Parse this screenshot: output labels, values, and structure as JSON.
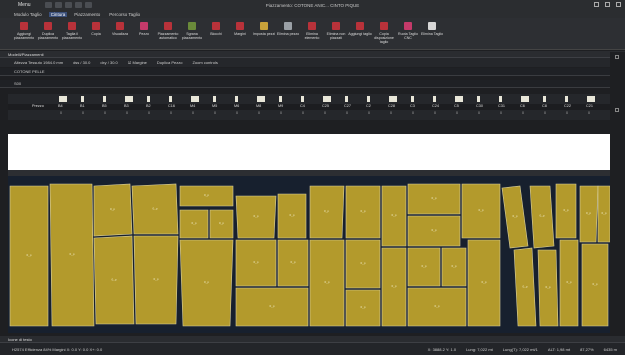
{
  "titlebar": {
    "menu": "Menu",
    "title": "Piazzamento: COTONE ANIC... CINTO PIQUE"
  },
  "tabs": [
    {
      "label": "Modulo Taglio",
      "active": false
    },
    {
      "label": "Cintura",
      "active": true
    },
    {
      "label": "Piazzamento",
      "active": false
    },
    {
      "label": "Percorso Taglio",
      "active": false
    }
  ],
  "ribbon": [
    {
      "label": "Aggiungi piazzamento",
      "icon": "add-marker-icon",
      "color": "#b8323a"
    },
    {
      "label": "Duplica piazzamento",
      "icon": "duplicate-icon",
      "color": "#b8323a"
    },
    {
      "label": "Taglia il piazzamento",
      "icon": "cut-marker-icon",
      "color": "#b8323a"
    },
    {
      "label": "Copia",
      "icon": "copy-icon",
      "color": "#b8323a"
    },
    {
      "label": "Visualizza",
      "icon": "view-icon",
      "color": "#b8323a"
    },
    {
      "label": "Pezzo",
      "icon": "piece-icon",
      "color": "#c43a6a"
    },
    {
      "label": "Piazzamento automatico",
      "icon": "auto-marker-icon",
      "color": "#b8323a"
    },
    {
      "label": "Sgrana piazzamento",
      "icon": "unplace-icon",
      "color": "#6a8a3a"
    },
    {
      "label": "Blocchi",
      "icon": "blocks-icon",
      "color": "#b8323a"
    },
    {
      "label": "Margini",
      "icon": "margins-icon",
      "color": "#b8323a"
    },
    {
      "label": "Imposta pezzi",
      "icon": "set-pieces-icon",
      "color": "#c8a23a"
    },
    {
      "label": "Elimina pezzo",
      "icon": "delete-piece-icon",
      "color": "#9aa0a6"
    },
    {
      "label": "Elimina elemento",
      "icon": "delete-element-icon",
      "color": "#b8323a"
    },
    {
      "label": "Elimina non piazzati",
      "icon": "delete-unplaced-icon",
      "color": "#b8323a"
    },
    {
      "label": "Aggiungi taglio",
      "icon": "add-cut-icon",
      "color": "#b8323a"
    },
    {
      "label": "Copia disposizione taglio",
      "icon": "copy-layout-icon",
      "color": "#b8323a"
    },
    {
      "label": "Ruota Taglio CNC",
      "icon": "flask-icon",
      "color": "#c43a6a"
    },
    {
      "label": "Elimina Taglio",
      "icon": "delete-cut-icon",
      "color": "#d6d6d6"
    }
  ],
  "section": {
    "title": "Modelli/Piazzamenti"
  },
  "options": {
    "height_label": "Altezza Tessuto 1984.0 mm",
    "field1": "dss / 30.0",
    "field2": "dxy / 30.0",
    "margins": "Margine",
    "duplicate": "Duplica Pezzo",
    "controls": "Zoom controls"
  },
  "fabric": {
    "name": "COTONE PELLE"
  },
  "size": {
    "label": "S00"
  },
  "strip": {
    "header": "Prezzo",
    "labels": [
      "B4",
      "B1",
      "B5",
      "B3",
      "B2",
      "C16",
      "M4",
      "M5",
      "M6",
      "M8",
      "M9",
      "C4",
      "C25",
      "C27",
      "C2",
      "C28",
      "C3",
      "C24",
      "C5",
      "C30",
      "C31",
      "C6",
      "C8",
      "C22",
      "C21"
    ],
    "values": [
      "0",
      "0",
      "0",
      "0",
      "0",
      "0",
      "0",
      "0",
      "0",
      "0",
      "0",
      "0",
      "0",
      "0",
      "0",
      "0",
      "0",
      "0",
      "0",
      "0",
      "0",
      "0",
      "0",
      "0",
      "0"
    ]
  },
  "canvas": {
    "piece_fill": "#b39a2c",
    "piece_stroke": "#d9d0a0",
    "label_text": "0_p",
    "bg": "#17202e"
  },
  "status": {
    "left": "Icone di testo",
    "info": "H2574  Efficienza 84%   Margini  X: 0.0   Y: 0.0   X+: 0.0",
    "coord": "X: 3888.2  Y: 1.0",
    "length": "Lung: 7,022 mt",
    "length2": "Lung(T): 7,022 mt/1",
    "alt": "ALT: 1,98 mt",
    "pct": "87,27%",
    "len3": "6435 m"
  }
}
